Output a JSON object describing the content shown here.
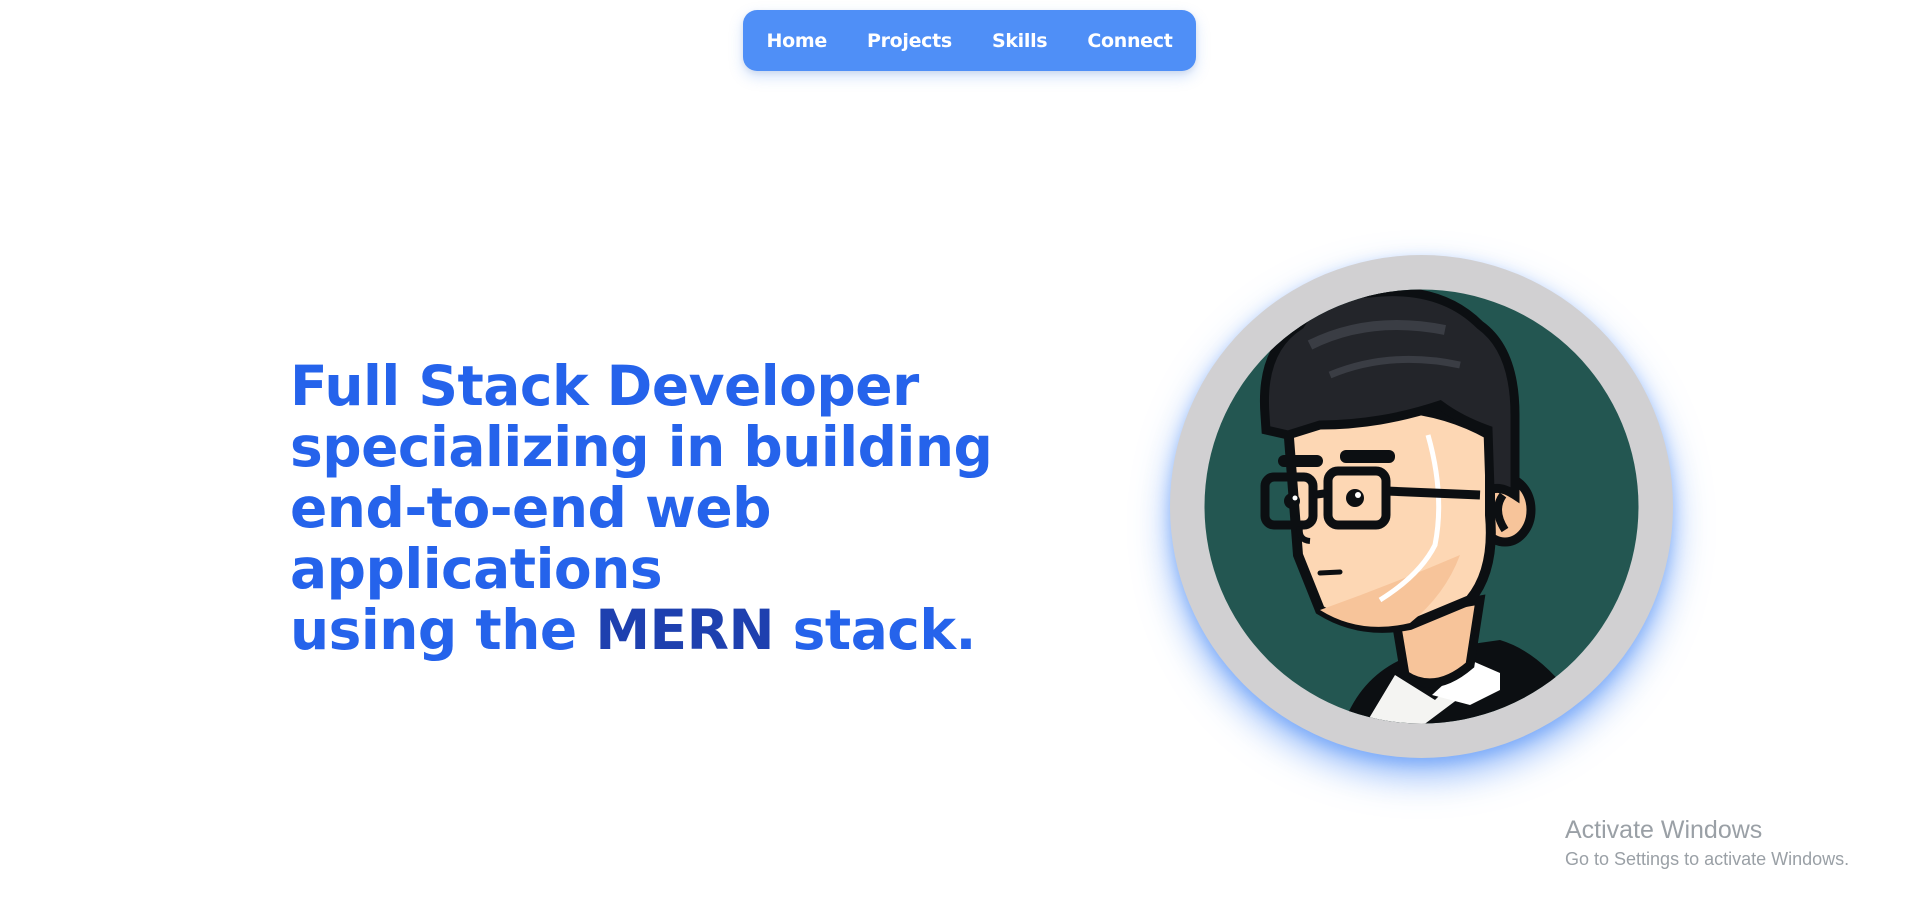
{
  "nav": {
    "items": [
      {
        "label": "Home"
      },
      {
        "label": "Projects"
      },
      {
        "label": "Skills"
      },
      {
        "label": "Connect"
      }
    ]
  },
  "hero": {
    "line1": "Full Stack Developer",
    "line2": "specializing in building",
    "line3": "end-to-end web",
    "line4": "applications",
    "line5_prefix": "using the ",
    "line5_accent": "MERN",
    "line5_suffix": " stack."
  },
  "avatar": {
    "icon": "developer-avatar-icon",
    "ring_color": "#d1d0d2",
    "background_color": "#235651"
  },
  "watermark": {
    "title": "Activate Windows",
    "subtitle": "Go to Settings to activate Windows."
  },
  "colors": {
    "nav_bg": "#4f8ff7",
    "hero_text": "#2563eb",
    "hero_accent": "#1e40af"
  }
}
